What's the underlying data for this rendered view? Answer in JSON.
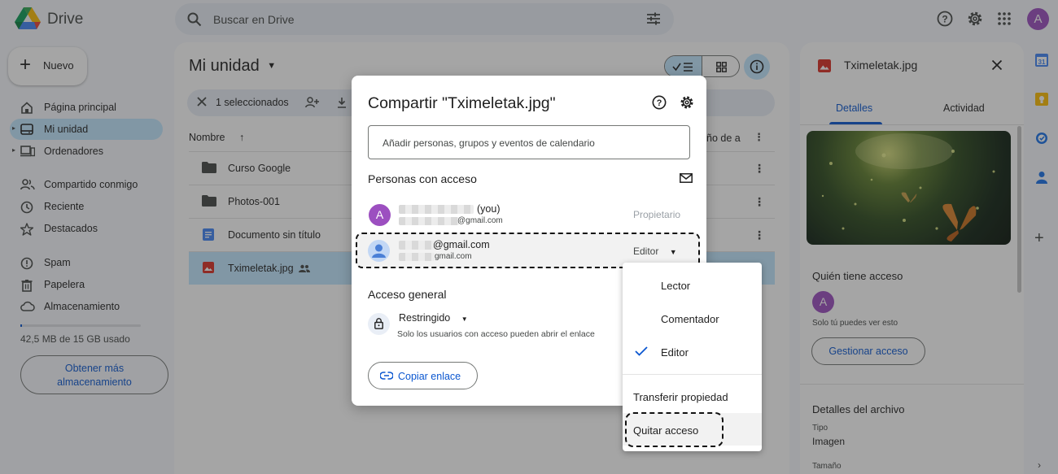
{
  "app": {
    "name": "Drive",
    "search_placeholder": "Buscar en Drive",
    "avatar_letter": "A"
  },
  "sidebar": {
    "new_label": "Nuevo",
    "items": [
      {
        "label": "Página principal",
        "icon": "home-icon"
      },
      {
        "label": "Mi unidad",
        "icon": "drive-icon",
        "active": true
      },
      {
        "label": "Ordenadores",
        "icon": "computer-icon"
      },
      {
        "label": "Compartido conmigo",
        "icon": "people-icon"
      },
      {
        "label": "Reciente",
        "icon": "clock-icon"
      },
      {
        "label": "Destacados",
        "icon": "star-icon"
      },
      {
        "label": "Spam",
        "icon": "spam-icon"
      },
      {
        "label": "Papelera",
        "icon": "trash-icon"
      },
      {
        "label": "Almacenamiento",
        "icon": "cloud-icon"
      }
    ],
    "storage_text": "42,5 MB de 15 GB usado",
    "storage_fraction": 0.003,
    "get_more_line1": "Obtener más",
    "get_more_line2": "almacenamiento"
  },
  "main": {
    "title": "Mi unidad",
    "selection_text": "1 seleccionados",
    "col_name": "Nombre",
    "col_size_partial": "ño de a",
    "files": [
      {
        "name": "Curso Google",
        "icon": "folder-icon"
      },
      {
        "name": "Photos-001",
        "icon": "folder-icon"
      },
      {
        "name": "Documento sin título",
        "icon": "doc-icon"
      },
      {
        "name": "Tximeletak.jpg",
        "icon": "image-icon",
        "selected": true
      }
    ]
  },
  "details_panel": {
    "file_name": "Tximeletak.jpg",
    "tabs": [
      "Detalles",
      "Actividad"
    ],
    "access_heading": "Quién tiene acceso",
    "avatar_letter": "A",
    "only_you_text": "Solo tú puedes ver esto",
    "manage_label": "Gestionar acceso",
    "file_details_heading": "Detalles del archivo",
    "type_label": "Tipo",
    "type_value": "Imagen",
    "size_label": "Tamaño"
  },
  "share_dialog": {
    "title": "Compartir \"Tximeletak.jpg\"",
    "input_placeholder": "Añadir personas, grupos y eventos de calendario",
    "people_heading": "Personas con acceso",
    "people": [
      {
        "avatar_letter": "A",
        "name_suffix": "(you)",
        "email_suffix": "@gmail.com",
        "role": "Propietario"
      },
      {
        "name_suffix": "@gmail.com",
        "email_suffix": "gmail.com",
        "role": "Editor"
      }
    ],
    "general_heading": "Acceso general",
    "restriction": "Restringido",
    "restriction_desc": "Solo los usuarios con acceso pueden abrir el enlace",
    "copy_link_label": "Copiar enlace"
  },
  "role_menu": {
    "roles": [
      "Lector",
      "Comentador",
      "Editor"
    ],
    "selected": "Editor",
    "transfer_label": "Transferir propiedad",
    "remove_label": "Quitar acceso"
  },
  "colors": {
    "accent": "#0b57d0",
    "selected_bg": "#c2e7ff",
    "avatar": "#9c4fc0"
  }
}
